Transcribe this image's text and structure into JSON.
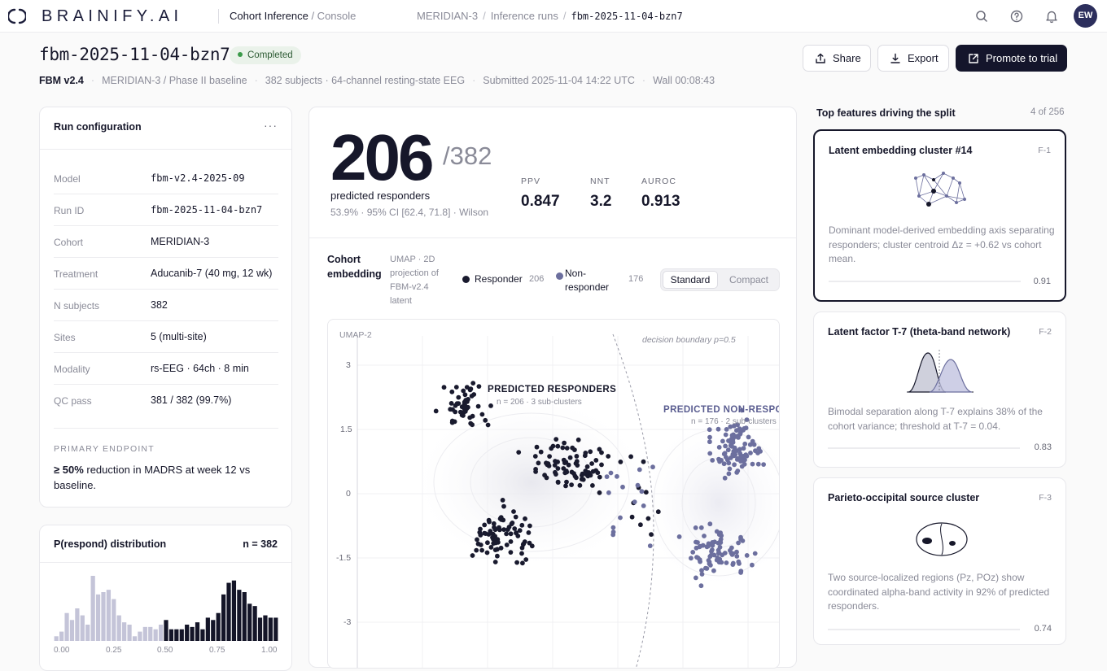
{
  "brand": {
    "name": "BRAINIFY.AI"
  },
  "app": {
    "name": "Cohort Inference",
    "section": " / Console"
  },
  "breadcrumb": [
    "MERIDIAN-3",
    "Inference runs",
    "fbm-2025-11-04-bzn7"
  ],
  "user": {
    "initials": "EW"
  },
  "run": {
    "title": "fbm-2025-11-04-bzn7",
    "status": "Completed",
    "model_tag": "FBM v2.4",
    "meta": [
      "MERIDIAN-3 / Phase II baseline",
      "382 subjects · 64-channel resting-state EEG",
      "Submitted 2025-11-04 14:22 UTC",
      "Wall 00:08:43"
    ]
  },
  "actions": {
    "share": "Share",
    "export": "Export",
    "promote": "Promote to trial"
  },
  "config": {
    "title": "Run configuration",
    "more": "···",
    "rows": [
      {
        "k": "Model",
        "v": "fbm-v2.4-2025-09"
      },
      {
        "k": "Run ID",
        "v": "fbm-2025-11-04-bzn7"
      },
      {
        "k": "Cohort",
        "v": "MERIDIAN-3"
      },
      {
        "k": "Treatment",
        "v": "Aducanib-7 (40 mg, 12 wk)"
      },
      {
        "k": "N subjects",
        "v": "382"
      },
      {
        "k": "Sites",
        "v": "5 (multi-site)"
      },
      {
        "k": "Modality",
        "v": "rs-EEG · 64ch · 8 min"
      },
      {
        "k": "QC pass",
        "v": "381 / 382 (99.7%)"
      }
    ],
    "endpoint_label": "PRIMARY ENDPOINT",
    "endpoint_strong": "≥ 50%",
    "endpoint_text": " reduction in MADRS at week 12 vs baseline."
  },
  "distribution": {
    "title": "P(respond) distribution",
    "n": "n = 382",
    "x_ticks": [
      "0.00",
      "0.25",
      "0.50",
      "0.75",
      "1.00"
    ],
    "threshold": 0.5,
    "colors": {
      "below": "#c4c4d8",
      "above": "#141528"
    },
    "bins": [
      2,
      4,
      12,
      9,
      14,
      11,
      7,
      28,
      20,
      21,
      22,
      18,
      11,
      8,
      7,
      2,
      4,
      6,
      6,
      5,
      7,
      9,
      5,
      5,
      5,
      7,
      6,
      8,
      5,
      10,
      9,
      12,
      20,
      25,
      26,
      22,
      21,
      16,
      15,
      10,
      11,
      10,
      10
    ]
  },
  "summary": {
    "responders": "206",
    "total": "/382",
    "label": "predicted responders",
    "ci": "53.9% · 95% CI [62.4, 71.8] · Wilson",
    "metrics": [
      {
        "k": "PPV",
        "v": "0.847"
      },
      {
        "k": "NNT",
        "v": "3.2"
      },
      {
        "k": "AUROC",
        "v": "0.913"
      }
    ]
  },
  "embedding": {
    "title": "Cohort embedding",
    "subtitle": "UMAP · 2D projection of FBM-v2.4 latent",
    "legend": [
      {
        "name": "Responder",
        "count": "206",
        "color": "#191a2e"
      },
      {
        "name": "Non-responder",
        "count": "176",
        "color": "#6c6f9e"
      }
    ],
    "view_options": [
      "Standard",
      "Compact"
    ],
    "y_axis_label": "UMAP-2",
    "y_ticks": [
      "3",
      "1.5",
      "0",
      "-1.5",
      "-3"
    ],
    "boundary_label": "decision boundary p=0.5",
    "cluster_r": {
      "title": "PREDICTED RESPONDERS",
      "sub": "n = 206 · 3 sub-clusters"
    },
    "cluster_n": {
      "title": "PREDICTED NON-RESPONDERS",
      "sub": "n = 176 · 2 sub-clusters"
    }
  },
  "features": {
    "title": "Top features driving the split",
    "count": "4 of 256",
    "items": [
      {
        "title": "Latent embedding cluster #14",
        "id": "F-1",
        "desc": "Dominant model-derived embedding axis separating responders; cluster centroid Δz = +0.62 vs cohort mean.",
        "score": "0.91",
        "icon": "network-graph-icon"
      },
      {
        "title": "Latent factor T-7 (theta-band network)",
        "id": "F-2",
        "desc": "Bimodal separation along T-7 explains 38% of the cohort variance; threshold at T-7 = 0.04.",
        "score": "0.83",
        "icon": "bimodal-distribution-icon"
      },
      {
        "title": "Parieto-occipital source cluster",
        "id": "F-3",
        "desc": "Two source-localized regions (Pz, POz) show coordinated alpha-band activity in 92% of predicted responders.",
        "score": "0.74",
        "icon": "brain-regions-icon"
      }
    ]
  }
}
